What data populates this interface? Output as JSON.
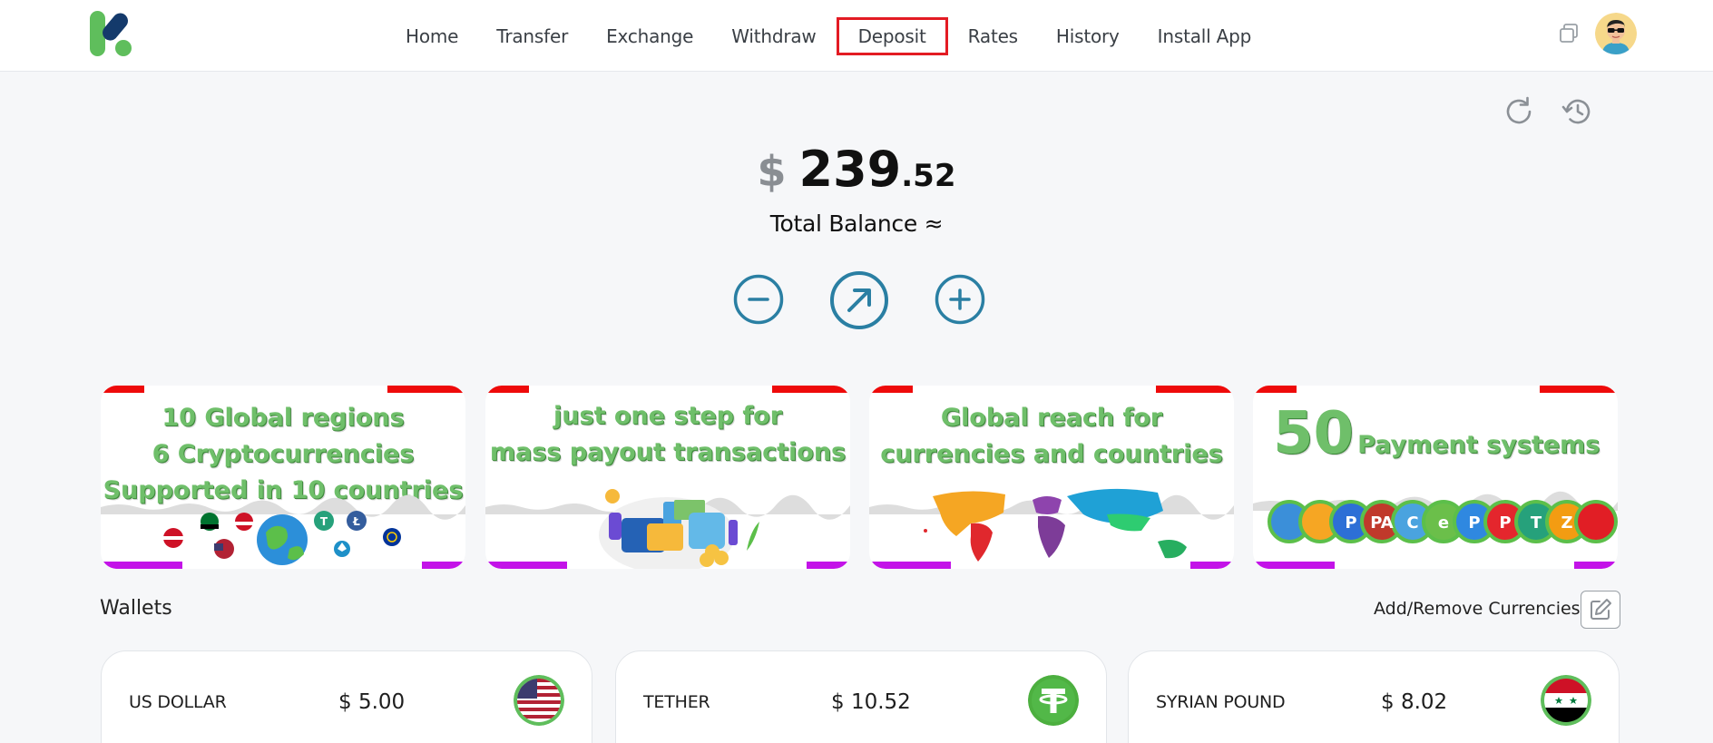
{
  "nav": {
    "items": [
      {
        "label": "Home"
      },
      {
        "label": "Transfer"
      },
      {
        "label": "Exchange"
      },
      {
        "label": "Withdraw"
      },
      {
        "label": "Deposit",
        "active": true
      },
      {
        "label": "Rates"
      },
      {
        "label": "History"
      },
      {
        "label": "Install App"
      }
    ],
    "icons": {
      "logo": "kasshs-logo",
      "copy": "copy-icon",
      "avatar": "user-avatar"
    }
  },
  "balance": {
    "currency_symbol": "$",
    "integer": "239",
    "decimal": ".52",
    "label": "Total Balance ≈"
  },
  "actions": [
    "withdraw-minus-icon",
    "transfer-arrow-icon",
    "deposit-plus-icon"
  ],
  "banners": [
    {
      "lines": [
        "10 Global regions",
        "6 Cryptocurrencies",
        "Supported in 10 countries"
      ]
    },
    {
      "lines": [
        "just one step for",
        "mass payout transactions"
      ]
    },
    {
      "lines": [
        "Global reach for",
        "currencies and countries"
      ]
    },
    {
      "big": "50",
      "rest": "Payment systems"
    }
  ],
  "wallets": {
    "title": "Wallets",
    "add_remove_label": "Add/Remove Currencies",
    "items": [
      {
        "name": "US DOLLAR",
        "amount": "$ 5.00",
        "icon": "us-flag-icon"
      },
      {
        "name": "TETHER",
        "amount": "$ 10.52",
        "icon": "tether-icon"
      },
      {
        "name": "SYRIAN POUND",
        "amount": "$ 8.02",
        "icon": "syria-flag-icon"
      }
    ]
  },
  "colors": {
    "accent": "#2a7fa3",
    "active_outline": "#e31b23",
    "banner_text": "#6fbf6a",
    "banner_red": "#ee0a0a",
    "banner_magenta": "#c313e8"
  }
}
